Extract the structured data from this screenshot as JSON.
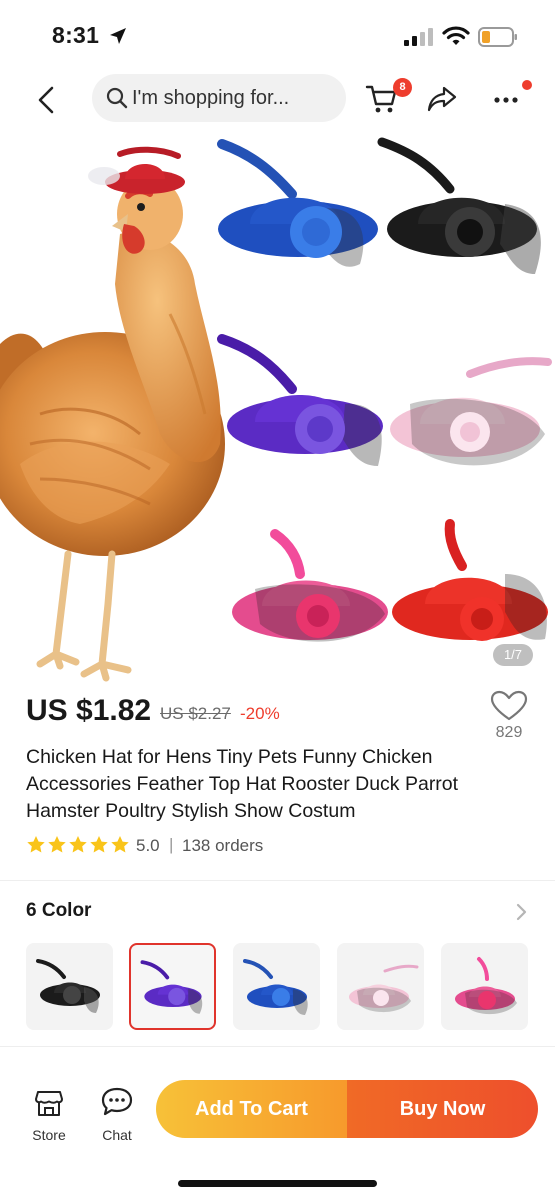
{
  "status_bar": {
    "time": "8:31"
  },
  "nav": {
    "search_placeholder": "I'm shopping for...",
    "cart_count": "8"
  },
  "gallery": {
    "counter": "1/7"
  },
  "product": {
    "price": "US $1.82",
    "original_price": "US $2.27",
    "discount": "-20%",
    "wishlist_count": "829",
    "title": "Chicken Hat for Hens Tiny Pets Funny Chicken Accessories Feather Top Hat Rooster Duck Parrot Hamster Poultry Stylish Show Costum",
    "rating": "5.0",
    "rating_separator": "|",
    "orders": "138 orders"
  },
  "colors": {
    "header": "6 Color",
    "swatches": [
      {
        "name": "black",
        "hex": "#1b1b1b"
      },
      {
        "name": "purple",
        "hex": "#5b2bc4",
        "selected": true
      },
      {
        "name": "blue",
        "hex": "#1f4fbf"
      },
      {
        "name": "light-pink",
        "hex": "#f3c4d6"
      },
      {
        "name": "pink",
        "hex": "#e44c8e"
      }
    ]
  },
  "bottom_bar": {
    "store_label": "Store",
    "chat_label": "Chat",
    "add_to_cart": "Add To Cart",
    "buy_now": "Buy Now"
  },
  "theme": {
    "accent_red": "#ee3d2d",
    "cart_gradient": [
      "#f7c138",
      "#f79a2c"
    ],
    "buy_gradient": [
      "#f06a26",
      "#ee4f2c"
    ],
    "star_color": "#f9c41a"
  },
  "icons": [
    "location-arrow-icon",
    "signal-icon",
    "wifi-icon",
    "battery-icon",
    "back-chevron-icon",
    "search-icon",
    "cart-icon",
    "share-icon",
    "more-icon",
    "heart-icon",
    "star-icon",
    "chevron-right-icon",
    "store-icon",
    "chat-icon"
  ]
}
